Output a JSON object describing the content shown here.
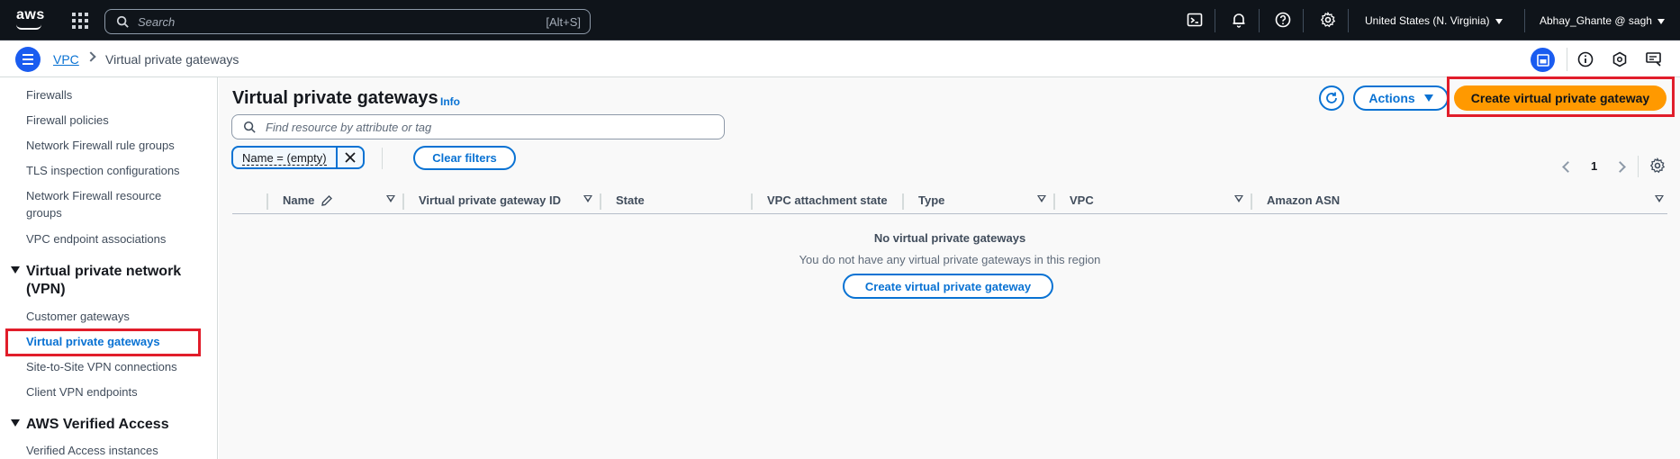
{
  "topnav": {
    "logo_text": "aws",
    "search_placeholder": "Search",
    "search_shortcut": "[Alt+S]",
    "region": "United States (N. Virginia)",
    "user": "Abhay_Ghante @ sagh"
  },
  "breadcrumb": {
    "parent": "VPC",
    "current": "Virtual private gateways"
  },
  "sidebar": {
    "items_top": [
      "Firewalls",
      "Firewall policies",
      "Network Firewall rule groups",
      "TLS inspection configurations",
      "Network Firewall resource groups",
      "VPC endpoint associations"
    ],
    "section_vpn": "Virtual private network (VPN)",
    "items_vpn": [
      "Customer gateways",
      "Virtual private gateways",
      "Site-to-Site VPN connections",
      "Client VPN endpoints"
    ],
    "section_verified": "AWS Verified Access",
    "items_verified": [
      "Verified Access instances"
    ]
  },
  "main": {
    "title": "Virtual private gateways",
    "info": "Info",
    "actions_label": "Actions",
    "create_label": "Create virtual private gateway",
    "filter_placeholder": "Find resource by attribute or tag",
    "token_label": "Name = (empty)",
    "clear_filters": "Clear filters",
    "page_number": "1",
    "columns": [
      "Name",
      "Virtual private gateway ID",
      "State",
      "VPC attachment state",
      "Type",
      "VPC",
      "Amazon ASN"
    ],
    "empty_title": "No virtual private gateways",
    "empty_subtitle": "You do not have any virtual private gateways in this region",
    "empty_create": "Create virtual private gateway"
  },
  "colors": {
    "accent": "#0972d3",
    "primary_button": "#ff9900",
    "topnav_bg": "#0f141a",
    "highlight": "#e11d2a"
  }
}
